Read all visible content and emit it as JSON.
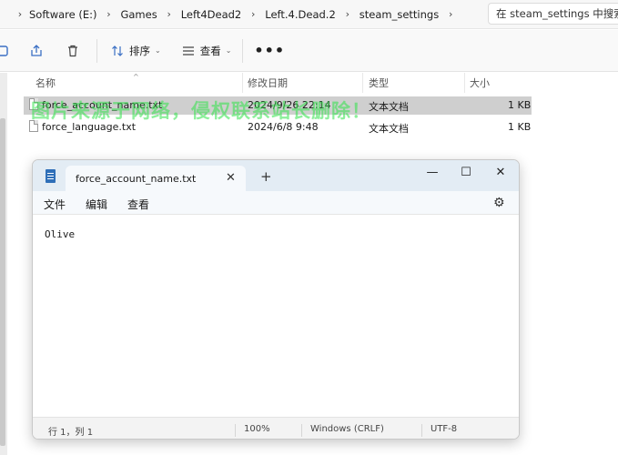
{
  "explorer": {
    "breadcrumbs": [
      "Software (E:)",
      "Games",
      "Left4Dead2",
      "Left.4.Dead.2",
      "steam_settings"
    ],
    "search_placeholder": "在 steam_settings 中搜索",
    "toolbar": {
      "sort_label": "排序",
      "view_label": "查看"
    },
    "columns": {
      "name": "名称",
      "modified": "修改日期",
      "type": "类型",
      "size": "大小"
    },
    "files": [
      {
        "name": "force_account_name.txt",
        "modified": "2024/9/26 22:14",
        "type": "文本文档",
        "size": "1 KB",
        "selected": true
      },
      {
        "name": "force_language.txt",
        "modified": "2024/6/8 9:48",
        "type": "文本文档",
        "size": "1 KB",
        "selected": false
      }
    ],
    "watermark": "图片来源于网络，侵权联系站长删除！"
  },
  "notepad": {
    "tab_title": "force_account_name.txt",
    "menu": {
      "file": "文件",
      "edit": "编辑",
      "view": "查看"
    },
    "content": "Olive",
    "status": {
      "position": "行 1，列 1",
      "zoom": "100%",
      "line_ending": "Windows (CRLF)",
      "encoding": "UTF-8"
    }
  },
  "icons": {
    "share": "share-icon",
    "delete": "trash-icon",
    "sort": "sort-icon",
    "view": "view-icon",
    "more": "more-icon",
    "settings": "gear-icon",
    "app": "notepad-app-icon"
  },
  "colors": {
    "accent_titlebar": "#e3ecf4",
    "selection": "#cfcfcf",
    "watermark": "#31e34a"
  }
}
